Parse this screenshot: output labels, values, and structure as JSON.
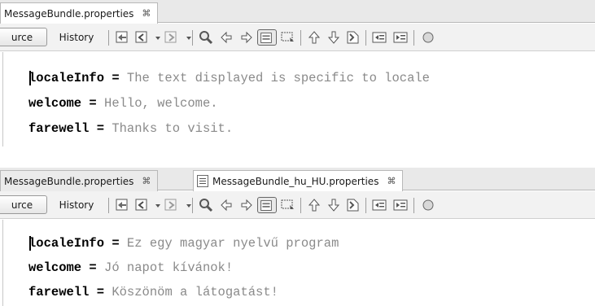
{
  "panel1": {
    "tabs": [
      {
        "label": "MessageBundle.properties",
        "close": "⌘",
        "active": true
      }
    ],
    "toolbar": {
      "source_label": "urce",
      "history_label": "History"
    },
    "lines": [
      {
        "key": "localeInfo",
        "eq": " = ",
        "value": "The text displayed is specific to locale"
      },
      {
        "key": "welcome",
        "eq": " = ",
        "value": "Hello, welcome."
      },
      {
        "key": "farewell",
        "eq": " = ",
        "value": "Thanks to visit."
      }
    ]
  },
  "panel2": {
    "tabs": [
      {
        "label": "MessageBundle.properties",
        "close": "⌘",
        "active": false
      },
      {
        "label": "MessageBundle_hu_HU.properties",
        "close": "⌘",
        "active": true
      }
    ],
    "toolbar": {
      "source_label": "urce",
      "history_label": "History"
    },
    "lines": [
      {
        "key": "localeInfo",
        "eq": " = ",
        "value": "Ez egy magyar nyelvű program"
      },
      {
        "key": "welcome",
        "eq": " = ",
        "value": "Jó napot kívánok!"
      },
      {
        "key": "farewell",
        "eq": " = ",
        "value": "Köszönöm a látogatást!"
      }
    ]
  },
  "icons": [
    "last-edit-icon",
    "back-icon",
    "dropdown-icon",
    "forward-icon",
    "dropdown-icon",
    "find-icon",
    "find-previous-icon",
    "find-next-icon",
    "toggle-highlight-icon",
    "toggle-rectangular-selection-icon",
    "previous-bookmark-icon",
    "next-bookmark-icon",
    "toggle-bookmark-icon",
    "shift-left-icon",
    "shift-right-icon",
    "start-macro-icon"
  ],
  "colors": {
    "value_text": "#8a8a8a",
    "key_text": "#000000",
    "tabbar_bg": "#e9e9e9",
    "toolbar_bg": "#f2f2f2"
  }
}
